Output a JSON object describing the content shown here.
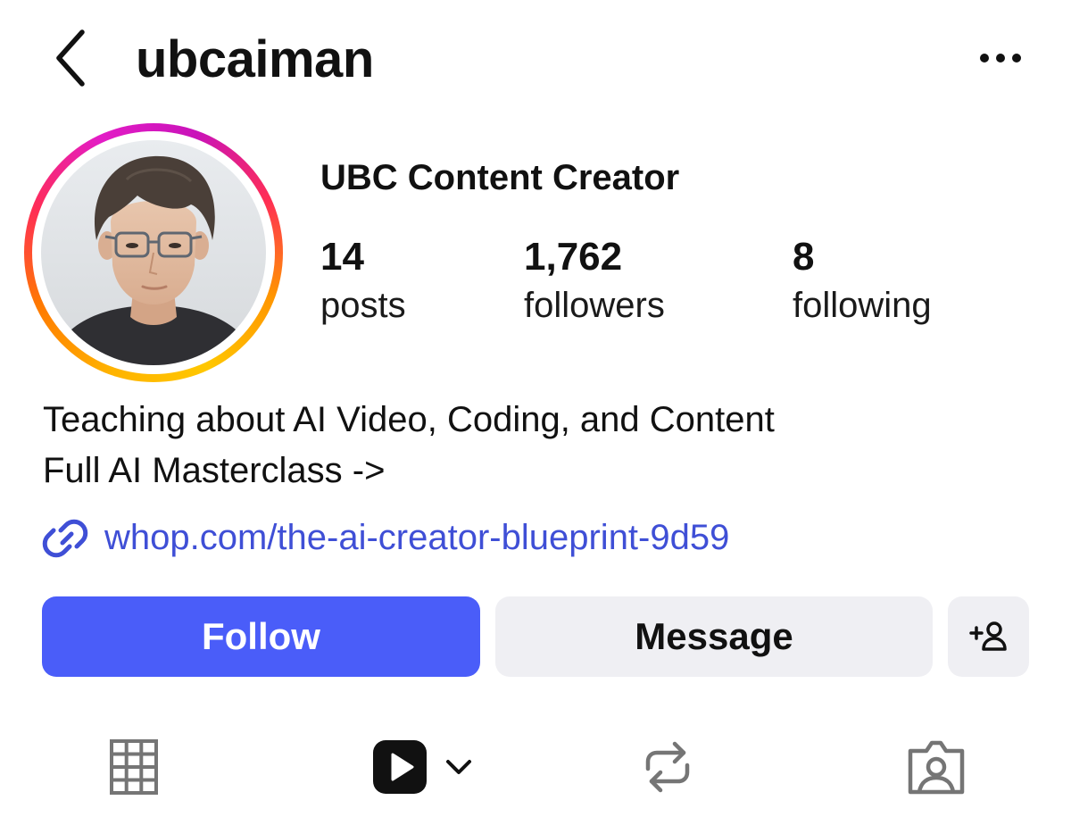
{
  "header": {
    "username": "ubcaiman",
    "back_icon": "chevron-left-icon",
    "more_icon": "ellipsis-icon"
  },
  "profile": {
    "display_name": "UBC Content Creator",
    "avatar_icon": "profile-photo",
    "story_ring_colors": [
      "#ffc700",
      "#ff7a00",
      "#ff2d55",
      "#c913b9"
    ],
    "stats": {
      "posts": {
        "count": "14",
        "label": "posts"
      },
      "followers": {
        "count": "1,762",
        "label": "followers"
      },
      "following": {
        "count": "8",
        "label": "following"
      }
    }
  },
  "bio": {
    "line1": "Teaching about AI Video, Coding, and Content",
    "line2": "Full AI Masterclass ->",
    "link_text": "whop.com/the-ai-creator-blueprint-9d59",
    "link_icon": "link-icon",
    "link_color": "#3f4fd6"
  },
  "actions": {
    "follow_label": "Follow",
    "message_label": "Message",
    "suggest_icon": "add-person-icon",
    "follow_color": "#4a5df9",
    "secondary_color": "#efeff3"
  },
  "tabs": {
    "grid_icon": "grid-icon",
    "reels_icon": "reels-play-icon",
    "reposts_icon": "repost-icon",
    "tagged_icon": "tagged-person-icon",
    "active": "reels"
  }
}
